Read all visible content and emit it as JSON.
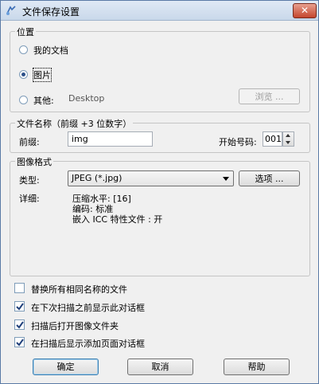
{
  "window": {
    "title": "文件保存设置",
    "close_glyph": "✕"
  },
  "location": {
    "legend": "位置",
    "options": [
      {
        "label": "我的文档",
        "selected": false
      },
      {
        "label": "图片",
        "selected": true
      },
      {
        "label": "其他:",
        "selected": false
      }
    ],
    "other_path": "Desktop",
    "browse_label": "浏览 ..."
  },
  "filename": {
    "legend": "文件名称（前缀 +3 位数字）",
    "prefix_label": "前缀:",
    "prefix_value": "img",
    "start_label": "开始号码:",
    "start_value": "001"
  },
  "format": {
    "legend": "图像格式",
    "type_label": "类型:",
    "type_value": "JPEG (*.jpg)",
    "options_label": "选项 ...",
    "details_label": "详细:",
    "details": [
      "压缩水平: [16]",
      "编码: 标准",
      "嵌入 ICC 特性文件 :  开"
    ]
  },
  "checkboxes": [
    {
      "label": "替换所有相同名称的文件",
      "checked": false
    },
    {
      "label": "在下次扫描之前显示此对话框",
      "checked": true
    },
    {
      "label": "扫描后打开图像文件夹",
      "checked": true
    },
    {
      "label": "在扫描后显示添加页面对话框",
      "checked": true
    }
  ],
  "buttons": {
    "ok": "确定",
    "cancel": "取消",
    "help": "帮助"
  },
  "colors": {
    "accent": "#2b4f88",
    "close": "#c4452d"
  }
}
